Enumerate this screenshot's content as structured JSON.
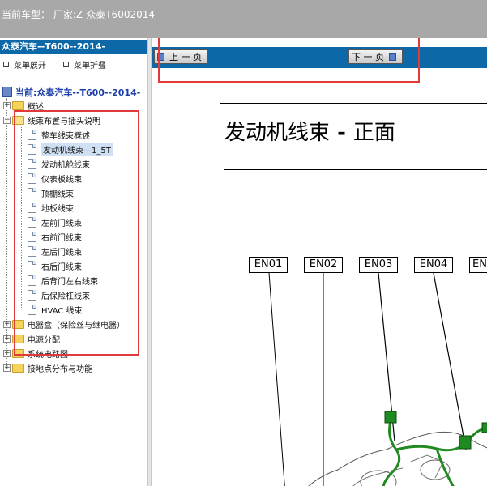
{
  "topbar": {
    "label": "当前车型：",
    "value": "厂家:Z-众泰T6002014-"
  },
  "sidebar": {
    "header": "众泰汽车--T600--2014-",
    "expand_all": "菜单展开",
    "collapse_all": "菜单折叠",
    "root": "当前:众泰汽车--T600--2014-",
    "items": [
      {
        "label": "概述"
      },
      {
        "label": "线束布置与插头说明"
      },
      {
        "label": "整车线束概述"
      },
      {
        "label": "发动机线束—1_5T"
      },
      {
        "label": "发动机舱线束"
      },
      {
        "label": "仪表板线束"
      },
      {
        "label": "顶棚线束"
      },
      {
        "label": "地板线束"
      },
      {
        "label": "左前门线束"
      },
      {
        "label": "右前门线束"
      },
      {
        "label": "左后门线束"
      },
      {
        "label": "右后门线束"
      },
      {
        "label": "后背门左右线束"
      },
      {
        "label": "后保险杠线束"
      },
      {
        "label": "HVAC 线束"
      },
      {
        "label": "电器盒（保险丝与继电器）"
      },
      {
        "label": "电源分配"
      },
      {
        "label": "系统电路图"
      },
      {
        "label": "接地点分布与功能"
      }
    ]
  },
  "content": {
    "prev_label": "上 一 页",
    "next_label": "下 一 页",
    "title_part1": "发动机线束",
    "title_sep": " - ",
    "title_part2": "正面",
    "connectors": [
      "EN01",
      "EN02",
      "EN03",
      "EN04",
      "EN"
    ]
  },
  "colors": {
    "accent": "#0d68a8",
    "highlight_box": "#e03a3a",
    "harness": "#1f8a1f"
  }
}
